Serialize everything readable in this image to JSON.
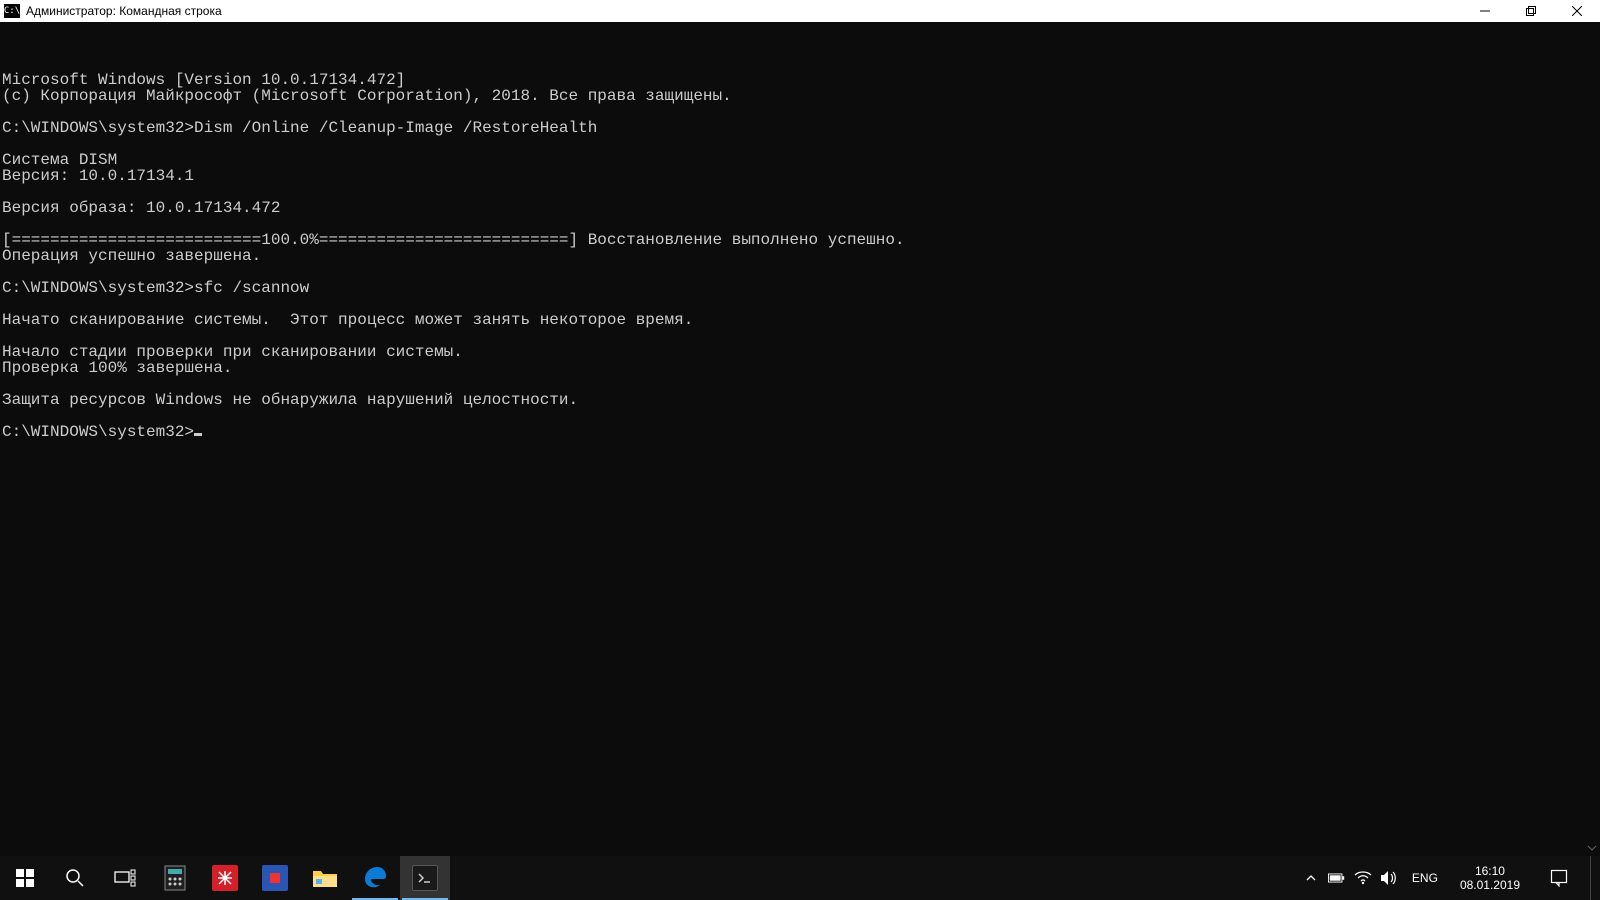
{
  "window": {
    "icon_text": "C:\\",
    "title": "Администратор: Командная строка"
  },
  "console": {
    "lines": [
      "Microsoft Windows [Version 10.0.17134.472]",
      "(c) Корпорация Майкрософт (Microsoft Corporation), 2018. Все права защищены.",
      "",
      "C:\\WINDOWS\\system32>Dism /Online /Cleanup-Image /RestoreHealth",
      "",
      "Cистема DISM",
      "Версия: 10.0.17134.1",
      "",
      "Версия образа: 10.0.17134.472",
      "",
      "[==========================100.0%==========================] Восстановление выполнено успешно.",
      "Операция успешно завершена.",
      "",
      "C:\\WINDOWS\\system32>sfc /scannow",
      "",
      "Начато сканирование системы.  Этот процесс может занять некоторое время.",
      "",
      "Начало стадии проверки при сканировании системы.",
      "Проверка 100% завершена.",
      "",
      "Защита ресурсов Windows не обнаружила нарушений целостности.",
      ""
    ],
    "prompt": "C:\\WINDOWS\\system32>"
  },
  "tray": {
    "lang": "ENG",
    "time": "16:10",
    "date": "08.01.2019"
  },
  "colors": {
    "console_bg": "#0c0c0c",
    "console_fg": "#cccccc",
    "taskbar_bg": "#101010",
    "accent": "#76b9ed"
  }
}
